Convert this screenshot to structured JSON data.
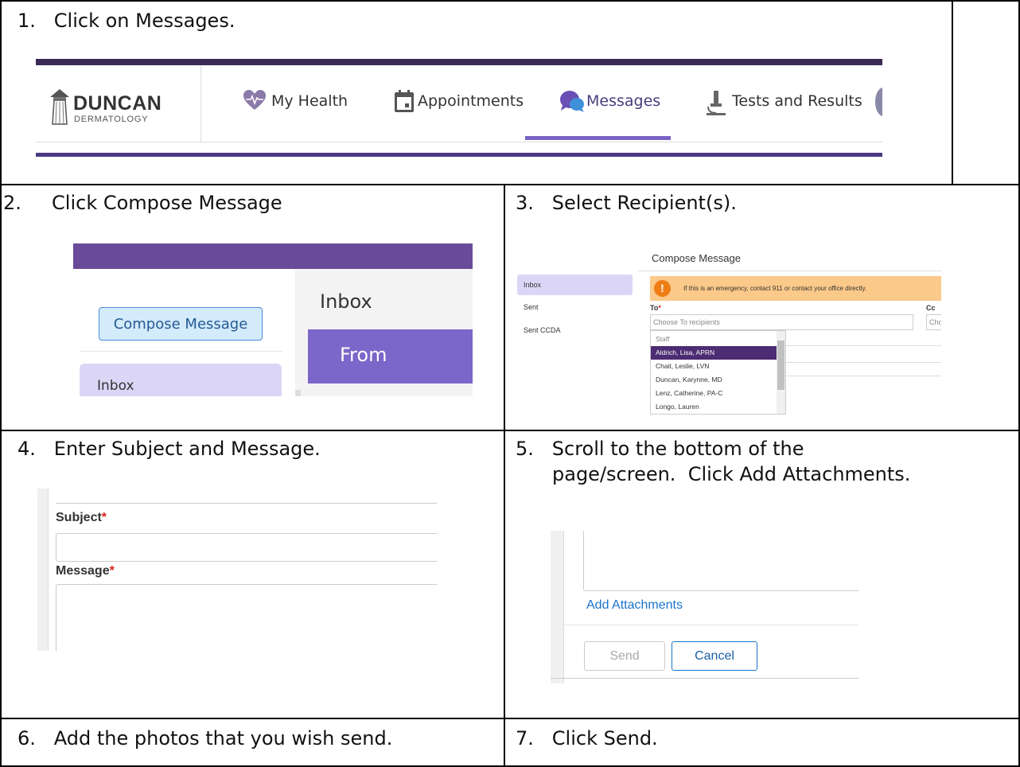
{
  "steps": {
    "s1": "1.   Click on Messages.",
    "s2": "2.     Click Compose Message",
    "s3": "3.   Select Recipient(s).",
    "s4": "4.   Enter Subject and Message.",
    "s5a": "5.   Scroll to the bottom of the",
    "s5b": "page/screen.  Click Add Attachments.",
    "s6": "6.   Add the photos that you wish send.",
    "s7": "7.   Click Send."
  },
  "nav": {
    "logo_name": "DUNCAN",
    "logo_sub": "DERMATOLOGY",
    "items": [
      "My Health",
      "Appointments",
      "Messages",
      "Tests and Results"
    ],
    "active": "Messages"
  },
  "compose": {
    "button": "Compose Message",
    "sidebar_item": "Inbox",
    "pane_title": "Inbox",
    "column_header": "From"
  },
  "recipients": {
    "sidebar": [
      "Inbox",
      "Sent",
      "Sent CCDA"
    ],
    "title": "Compose Message",
    "alert": "If this is an emergency, contact 911 or contact your office directly.",
    "to_label": "To",
    "cc_label": "Cc",
    "to_placeholder": "Choose To recipients",
    "cc_placeholder": "Cho",
    "group": "Staff",
    "options": [
      "Aldrich, Lisa, APRN",
      "Chait, Leslie, LVN",
      "Duncan, Karynne, MD",
      "Lenz, Catherine, PA-C",
      "Longo, Lauren"
    ],
    "highlighted": "Aldrich, Lisa, APRN"
  },
  "message_form": {
    "subject_label": "Subject",
    "message_label": "Message",
    "required_mark": "*"
  },
  "attachments": {
    "link": "Add Attachments",
    "send": "Send",
    "cancel": "Cancel"
  },
  "colors": {
    "brand_purple": "#4a3880",
    "accent_purple": "#7b66c9",
    "alert_orange": "#fbc989",
    "link_blue": "#1a73c9"
  }
}
